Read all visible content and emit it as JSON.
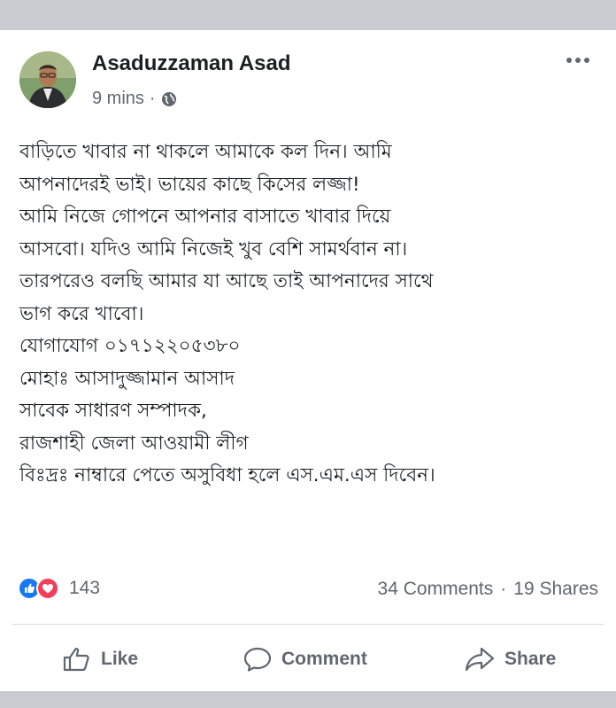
{
  "post": {
    "author": "Asaduzzaman Asad",
    "time": "9 mins",
    "separator": "·",
    "privacy_icon": "globe-icon",
    "more_icon": "more-options-icon",
    "lines": [
      "বাড়িতে খাবার না থাকলে আমাকে কল দিন। আমি",
      "আপনাদেরই ভাই। ভায়ের কাছে কিসের লজ্জা!",
      "আমি নিজে গোপনে আপনার বাসাতে খাবার দিয়ে",
      "আসবো। যদিও আমি নিজেই খুব বেশি সামর্থবান না।",
      "তারপরেও বলছি আমার যা আছে তাই আপনাদের সাথে",
      "ভাগ করে খাবো।",
      "যোগাযোগ ০১৭১২২০৫৩৮০",
      "মোহাঃ আসাদুজ্জামান আসাদ",
      "সাবেক সাধারণ সম্পাদক,",
      "রাজশাহী জেলা আওয়ামী লীগ",
      "বিঃদ্রঃ নাম্বারে পেতে অসুবিধা হলে এস.এম.এস দিবেন।"
    ]
  },
  "engagement": {
    "reaction_count": "143",
    "comments": "34 Comments",
    "dot": "·",
    "shares": "19 Shares",
    "reaction_icons": [
      "like-reaction-icon",
      "love-reaction-icon"
    ]
  },
  "actions": {
    "like": "Like",
    "comment": "Comment",
    "share": "Share"
  },
  "colors": {
    "like_blue": "#1877f2",
    "love_red": "#f33e58",
    "secondary_text": "#606770",
    "frame_band": "#c9ccd1"
  }
}
